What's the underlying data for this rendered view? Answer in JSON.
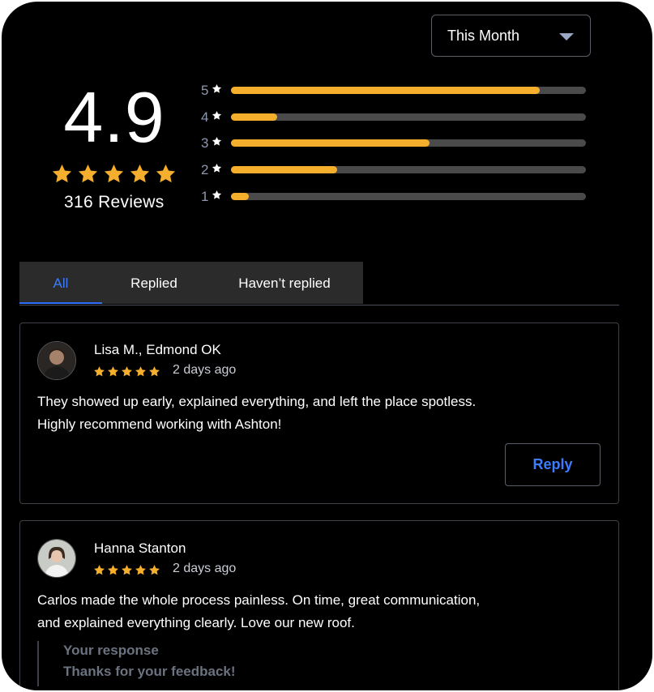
{
  "filter": {
    "selected": "This Month",
    "icon": "caret-down-icon"
  },
  "summary": {
    "average": "4.9",
    "stars": 5,
    "review_count_label": "316 Reviews",
    "star_color": "#f6ae2d"
  },
  "distribution": [
    {
      "stars": "5",
      "fraction": 0.87
    },
    {
      "stars": "4",
      "fraction": 0.13
    },
    {
      "stars": "3",
      "fraction": 0.56
    },
    {
      "stars": "2",
      "fraction": 0.3
    },
    {
      "stars": "1",
      "fraction": 0.05
    }
  ],
  "tabs": [
    {
      "label": "All",
      "active": true
    },
    {
      "label": "Replied",
      "active": false
    },
    {
      "label": "Haven’t replied",
      "active": false
    }
  ],
  "reviews": [
    {
      "name": "Lisa M., Edmond OK",
      "rating": 5,
      "date": "2 days ago",
      "text_lines": [
        "They showed up early, explained everything, and left the place spotless.",
        "Highly recommend working with Ashton!"
      ],
      "action_label": "Reply"
    },
    {
      "name": "Hanna Stanton",
      "rating": 5,
      "date": "2 days ago",
      "text_lines": [
        "Carlos made the whole process painless. On time, great communication,",
        "and explained everything clearly. Love our new roof."
      ],
      "response_title": "Your response",
      "response_text": "Thanks for your feedback!"
    }
  ],
  "colors": {
    "accent": "#3d7bff",
    "bar_track": "#4a4a4a",
    "bar_fill": "#f6ae2d",
    "background": "#000000"
  }
}
